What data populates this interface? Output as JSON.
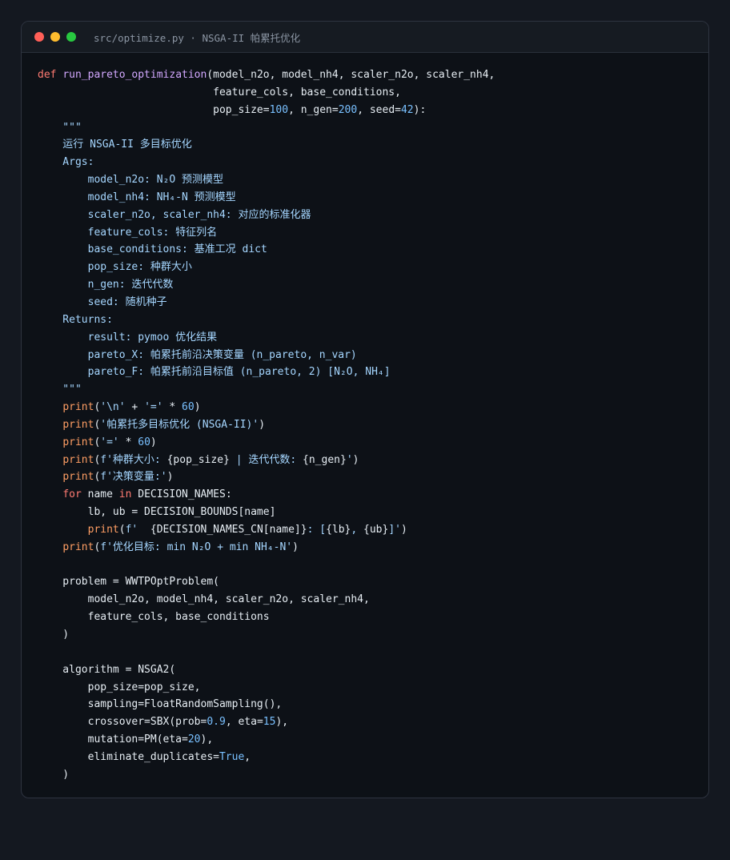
{
  "window": {
    "title": "src/optimize.py · NSGA-II 帕累托优化"
  },
  "code_lines": [
    [
      {
        "t": "def",
        "c": "kw"
      },
      {
        "t": " "
      },
      {
        "t": "run_pareto_optimization",
        "c": "fn"
      },
      {
        "t": "(model_n2o, model_nh4, scaler_n2o, scaler_nh4,"
      }
    ],
    [
      {
        "t": "                            feature_cols, base_conditions,"
      }
    ],
    [
      {
        "t": "                            pop_size="
      },
      {
        "t": "100",
        "c": "num"
      },
      {
        "t": ", n_gen="
      },
      {
        "t": "200",
        "c": "num"
      },
      {
        "t": ", seed="
      },
      {
        "t": "42",
        "c": "num"
      },
      {
        "t": "):"
      }
    ],
    [
      {
        "t": "    \"\"\"",
        "c": "doc"
      }
    ],
    [
      {
        "t": "    运行 NSGA-II 多目标优化",
        "c": "doc"
      }
    ],
    [
      {
        "t": "    Args:",
        "c": "doc"
      }
    ],
    [
      {
        "t": "        model_n2o: N₂O 预测模型",
        "c": "doc"
      }
    ],
    [
      {
        "t": "        model_nh4: NH₄-N 预测模型",
        "c": "doc"
      }
    ],
    [
      {
        "t": "        scaler_n2o, scaler_nh4: 对应的标准化器",
        "c": "doc"
      }
    ],
    [
      {
        "t": "        feature_cols: 特征列名",
        "c": "doc"
      }
    ],
    [
      {
        "t": "        base_conditions: 基准工况 dict",
        "c": "doc"
      }
    ],
    [
      {
        "t": "        pop_size: 种群大小",
        "c": "doc"
      }
    ],
    [
      {
        "t": "        n_gen: 迭代代数",
        "c": "doc"
      }
    ],
    [
      {
        "t": "        seed: 随机种子",
        "c": "doc"
      }
    ],
    [
      {
        "t": "    Returns:",
        "c": "doc"
      }
    ],
    [
      {
        "t": "        result: pymoo 优化结果",
        "c": "doc"
      }
    ],
    [
      {
        "t": "        pareto_X: 帕累托前沿决策变量 (n_pareto, n_var)",
        "c": "doc"
      }
    ],
    [
      {
        "t": "        pareto_F: 帕累托前沿目标值 (n_pareto, 2) [N₂O, NH₄]",
        "c": "doc"
      }
    ],
    [
      {
        "t": "    \"\"\"",
        "c": "doc"
      }
    ],
    [
      {
        "t": "    "
      },
      {
        "t": "print",
        "c": "fn2"
      },
      {
        "t": "("
      },
      {
        "t": "'\\n'",
        "c": "str"
      },
      {
        "t": " + "
      },
      {
        "t": "'='",
        "c": "str"
      },
      {
        "t": " * "
      },
      {
        "t": "60",
        "c": "num"
      },
      {
        "t": ")"
      }
    ],
    [
      {
        "t": "    "
      },
      {
        "t": "print",
        "c": "fn2"
      },
      {
        "t": "("
      },
      {
        "t": "'帕累托多目标优化 (NSGA-II)'",
        "c": "str"
      },
      {
        "t": ")"
      }
    ],
    [
      {
        "t": "    "
      },
      {
        "t": "print",
        "c": "fn2"
      },
      {
        "t": "("
      },
      {
        "t": "'='",
        "c": "str"
      },
      {
        "t": " * "
      },
      {
        "t": "60",
        "c": "num"
      },
      {
        "t": ")"
      }
    ],
    [
      {
        "t": "    "
      },
      {
        "t": "print",
        "c": "fn2"
      },
      {
        "t": "("
      },
      {
        "t": "f'种群大小: ",
        "c": "str"
      },
      {
        "t": "{pop_size}"
      },
      {
        "t": " | 迭代代数: ",
        "c": "str"
      },
      {
        "t": "{n_gen}"
      },
      {
        "t": "'",
        "c": "str"
      },
      {
        "t": ")"
      }
    ],
    [
      {
        "t": "    "
      },
      {
        "t": "print",
        "c": "fn2"
      },
      {
        "t": "("
      },
      {
        "t": "f'决策变量:'",
        "c": "str"
      },
      {
        "t": ")"
      }
    ],
    [
      {
        "t": "    "
      },
      {
        "t": "for",
        "c": "kw"
      },
      {
        "t": " name "
      },
      {
        "t": "in",
        "c": "kw"
      },
      {
        "t": " DECISION_NAMES:"
      }
    ],
    [
      {
        "t": "        lb, ub = DECISION_BOUNDS[name]"
      }
    ],
    [
      {
        "t": "        "
      },
      {
        "t": "print",
        "c": "fn2"
      },
      {
        "t": "("
      },
      {
        "t": "f'  ",
        "c": "str"
      },
      {
        "t": "{DECISION_NAMES_CN[name]}"
      },
      {
        "t": ": [",
        "c": "str"
      },
      {
        "t": "{lb}"
      },
      {
        "t": ", ",
        "c": "str"
      },
      {
        "t": "{ub}"
      },
      {
        "t": "]'",
        "c": "str"
      },
      {
        "t": ")"
      }
    ],
    [
      {
        "t": "    "
      },
      {
        "t": "print",
        "c": "fn2"
      },
      {
        "t": "("
      },
      {
        "t": "f'优化目标: min N₂O + min NH₄-N'",
        "c": "str"
      },
      {
        "t": ")"
      }
    ],
    [
      {
        "t": ""
      }
    ],
    [
      {
        "t": "    problem = WWTPOptProblem("
      }
    ],
    [
      {
        "t": "        model_n2o, model_nh4, scaler_n2o, scaler_nh4,"
      }
    ],
    [
      {
        "t": "        feature_cols, base_conditions"
      }
    ],
    [
      {
        "t": "    )"
      }
    ],
    [
      {
        "t": ""
      }
    ],
    [
      {
        "t": "    algorithm = NSGA2("
      }
    ],
    [
      {
        "t": "        pop_size=pop_size,"
      }
    ],
    [
      {
        "t": "        sampling=FloatRandomSampling(),"
      }
    ],
    [
      {
        "t": "        crossover=SBX(prob="
      },
      {
        "t": "0.9",
        "c": "num"
      },
      {
        "t": ", eta="
      },
      {
        "t": "15",
        "c": "num"
      },
      {
        "t": "),"
      }
    ],
    [
      {
        "t": "        mutation=PM(eta="
      },
      {
        "t": "20",
        "c": "num"
      },
      {
        "t": "),"
      }
    ],
    [
      {
        "t": "        eliminate_duplicates="
      },
      {
        "t": "True",
        "c": "num"
      },
      {
        "t": ","
      }
    ],
    [
      {
        "t": "    )"
      }
    ]
  ]
}
